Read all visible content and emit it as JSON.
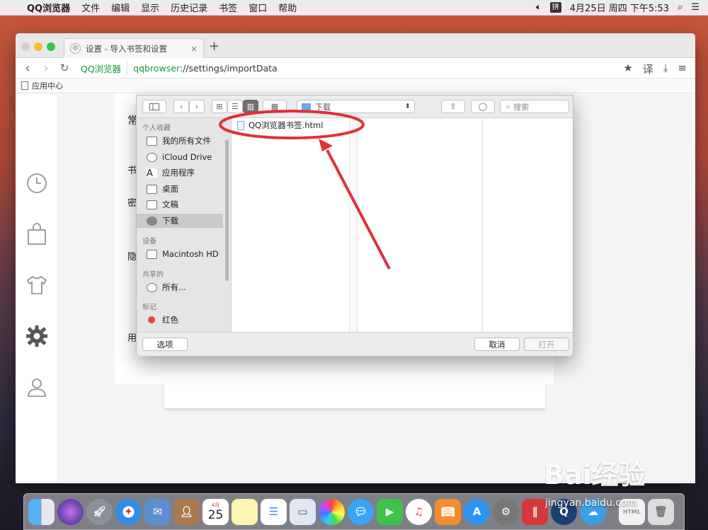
{
  "menubar": {
    "app": "QQ浏览器",
    "items": [
      "文件",
      "编辑",
      "显示",
      "历史记录",
      "书签",
      "窗口",
      "帮助"
    ],
    "ime": "拼",
    "clock": "4月25日 周四 下午5:53"
  },
  "browser": {
    "tab_title": "设置 - 导入书签和设置",
    "tab_close": "×",
    "new_tab": "+",
    "brand": "QQ浏览器",
    "url_scheme": "qqbrowser",
    "url_rest": "://settings/importData",
    "translate": "译",
    "bookmark_item": "应用中心"
  },
  "settings_bg": {
    "labels": [
      "常",
      "书",
      "密",
      "隐",
      "用"
    ]
  },
  "dialog": {
    "path": "下载",
    "search_placeholder": "搜索",
    "sidebar": {
      "sections": {
        "favorites": "个人收藏",
        "devices": "设备",
        "shared": "共享的",
        "tags": "标记"
      },
      "favorites": [
        "我的所有文件",
        "iCloud Drive",
        "应用程序",
        "桌面",
        "文稿",
        "下载"
      ],
      "devices": [
        "Macintosh HD"
      ],
      "shared": [
        "所有..."
      ],
      "tags": [
        "红色"
      ]
    },
    "file": "QQ浏览器书签.html",
    "options_button": "选项",
    "cancel_button": "取消",
    "open_button": "打开"
  },
  "dock": {
    "calendar_month": "4月",
    "calendar_day": "25"
  },
  "watermark": {
    "logo": "Bai经验",
    "url": "jingyan.baidu.com"
  },
  "colors": {
    "brand_green": "#1a9a3c",
    "annotation_red": "#e0303a",
    "close": "#fc5f57",
    "minimize": "#fdbc2e",
    "zoom": "#33c748"
  }
}
